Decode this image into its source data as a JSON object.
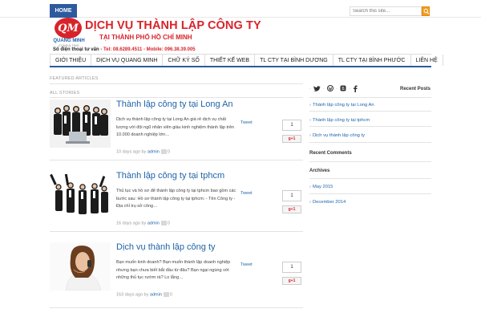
{
  "topbar": {
    "home_label": "HOME",
    "search_placeholder": "Search this site..."
  },
  "header": {
    "logo_initials": "QM",
    "logo_name": "QUANG MINH",
    "logo_sub": "CONSULTING",
    "title": "DỊCH VỤ THÀNH LẬP CÔNG TY",
    "subtitle": "TẠI THÀNH PHỐ HỒ CHÍ MINH",
    "hotline_label": "Số điện thoại tư vấn",
    "hotline_numbers": " - Tel: 08.6289.4511 - Mobile: 096.38.39.005"
  },
  "nav": {
    "items": [
      "GIỚI THIỆU",
      "DỊCH VỤ QUANG MINH",
      "CHỮ KÝ SỐ",
      "THIẾT KẾ WEB",
      "TL CTY TẠI BÌNH DƯƠNG",
      "TL CTY TẠI BÌNH PHƯỚC",
      "LIÊN HỆ"
    ]
  },
  "main": {
    "featured_label": "FEATURED ARTICLES",
    "all_stories_label": "ALL STORIES",
    "posts": [
      {
        "title": "Thành lập công ty tại Long An",
        "excerpt": "Dịch vụ thành lập công ty tại Long An giá rẻ dịch vụ chất lượng với đội ngũ nhân viên giàu kinh nghiệm thành lập trên 10.000 doanh nghiệp lớn…",
        "days_ago": "10 days ago by ",
        "author": "admin",
        "comments": "0",
        "tweet": "Tweet",
        "share_count": "1",
        "gplus": "g+1"
      },
      {
        "title": "Thành lập công ty tại tphcm",
        "excerpt": "Thủ tục và hồ sơ để thành lập công ty tại tphcm bao gồm các bước sau: Hồ sơ thành lập công ty tại tphcm: - Tên Công ty - Địa chỉ trụ sở công…",
        "days_ago": "16 days ago by ",
        "author": "admin",
        "comments": "0",
        "tweet": "Tweet",
        "share_count": "1",
        "gplus": "g+1"
      },
      {
        "title": "Dịch vụ thành lập công ty",
        "excerpt": "Bạn muốn kinh doanh? Bạn muốn thành lập doanh nghiệp nhưng bạn chưa biết bắt đầu từ đâu? Bạn ngại ngùng với những thủ tục rườm rà? Lo lắng…",
        "days_ago": "163 days ago by ",
        "author": "admin",
        "comments": "0",
        "tweet": "Tweet",
        "share_count": "1",
        "gplus": "g+1"
      }
    ]
  },
  "sidebar": {
    "recent_posts_title": "Recent Posts",
    "recent_posts": [
      "Thành lập công ty tại Long An",
      "Thành lập công ty tại tphcm",
      "Dịch vụ thành lập công ty"
    ],
    "recent_comments_title": "Recent Comments",
    "archives_title": "Archives",
    "archives": [
      "May 2015",
      "December 2014"
    ]
  },
  "colors": {
    "brand_red": "#d8232a",
    "link_blue": "#1e63a8",
    "nav_blue": "#2d5a9e",
    "search_orange": "#f39c1f"
  }
}
